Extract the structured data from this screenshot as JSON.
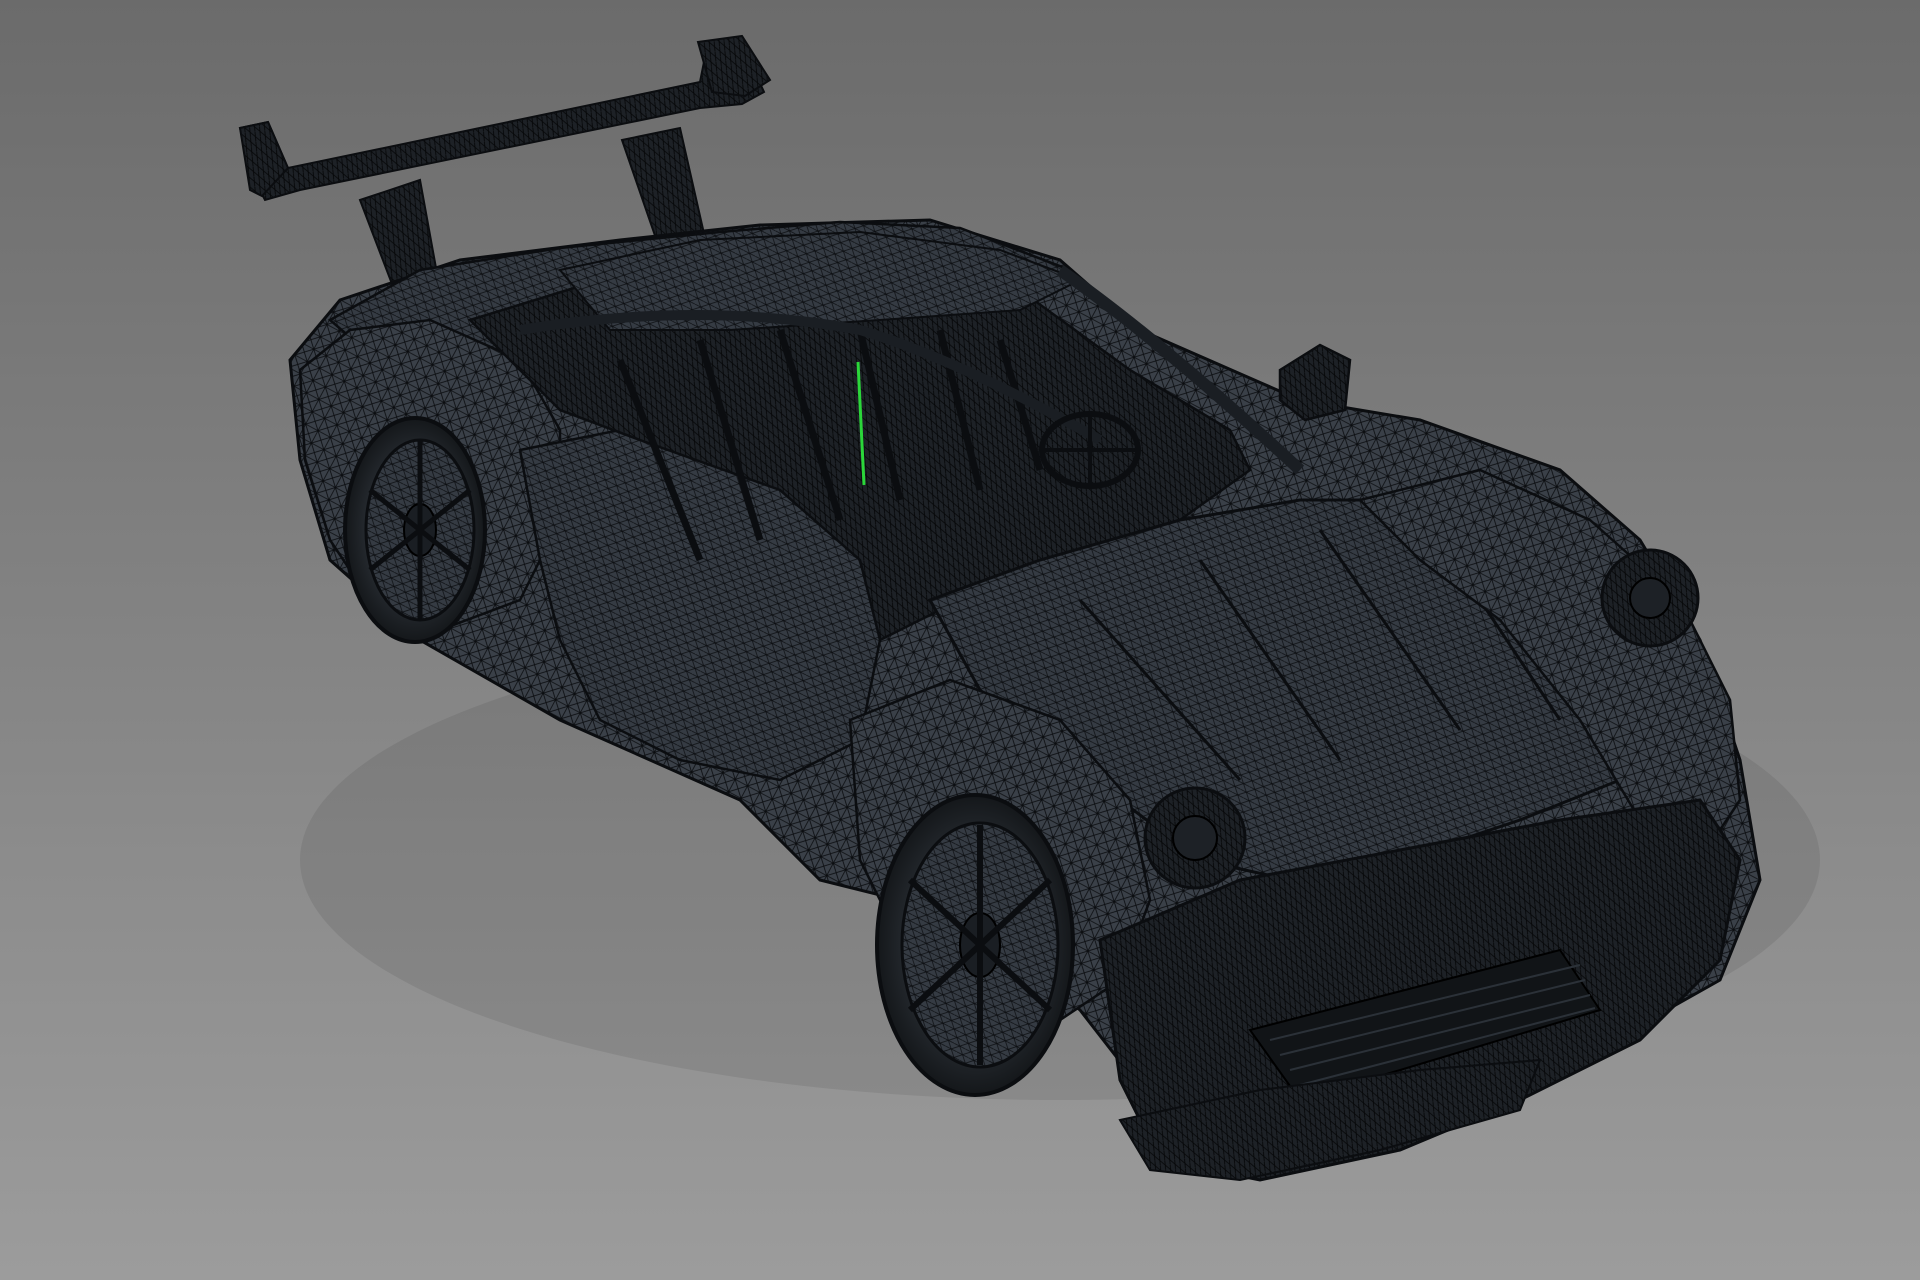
{
  "viewport": {
    "background_top": "#6b6b6b",
    "background_bottom": "#9c9c9c",
    "model": "wireframe-sports-car",
    "mesh_fill": "#3a4048",
    "mesh_dark": "#1d2126",
    "wire_color": "#0b0d10",
    "axis_color": "#2bd63a"
  }
}
